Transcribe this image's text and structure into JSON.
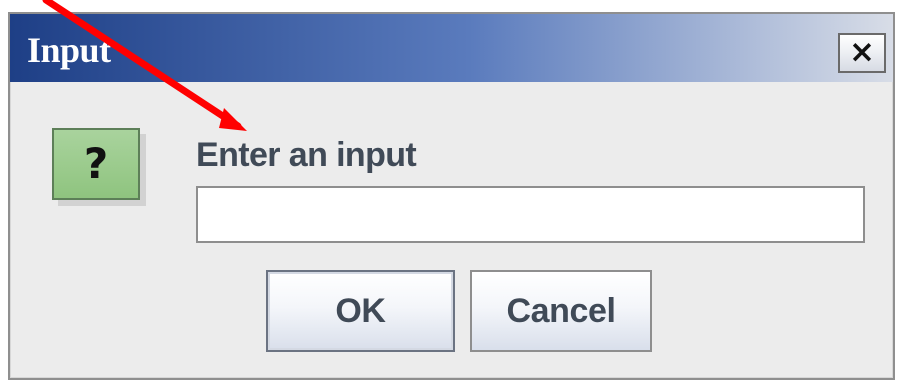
{
  "dialog": {
    "title": "Input",
    "close_icon": "close-icon",
    "close_label": "×"
  },
  "prompt": {
    "icon_name": "question-icon",
    "icon_label": "?",
    "label": "Enter an input",
    "input_value": ""
  },
  "buttons": {
    "ok_label": "OK",
    "cancel_label": "Cancel"
  },
  "annotation": {
    "arrow_color": "#ff0000"
  }
}
